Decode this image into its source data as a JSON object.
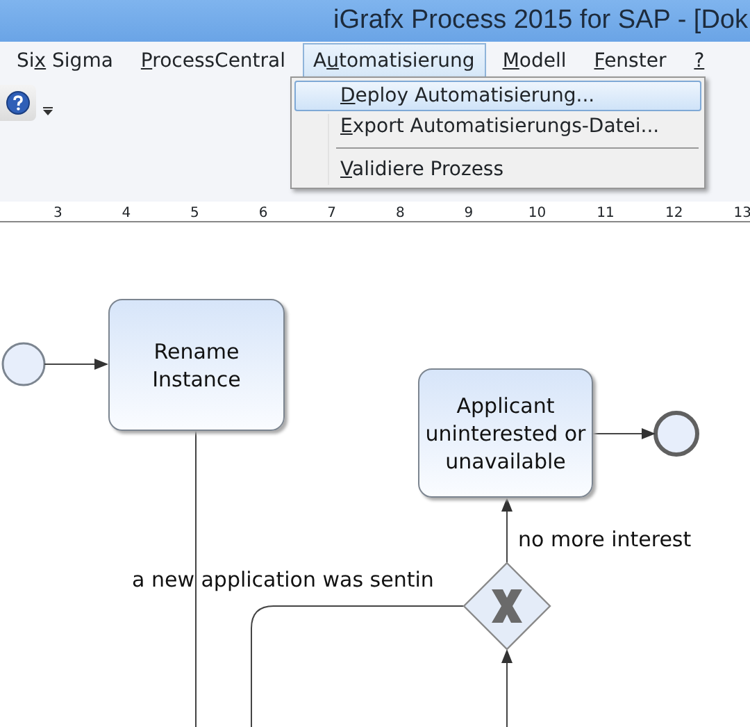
{
  "window": {
    "title": "iGrafx Process 2015 for SAP - [Dok"
  },
  "menu": [
    {
      "parts": [
        {
          "text": "Si",
          "underlined": false
        },
        {
          "text": "x",
          "underlined": true
        },
        {
          "text": " Sigma",
          "underlined": false
        }
      ],
      "selected": false
    },
    {
      "parts": [
        {
          "text": "P",
          "underlined": true
        },
        {
          "text": "rocessCentral",
          "underlined": false
        }
      ],
      "selected": false
    },
    {
      "parts": [
        {
          "text": "A",
          "underlined": false
        },
        {
          "text": "u",
          "underlined": true
        },
        {
          "text": "tomatisierung",
          "underlined": false
        }
      ],
      "selected": true
    },
    {
      "parts": [
        {
          "text": "M",
          "underlined": true
        },
        {
          "text": "odell",
          "underlined": false
        }
      ],
      "selected": false
    },
    {
      "parts": [
        {
          "text": "F",
          "underlined": true
        },
        {
          "text": "enster",
          "underlined": false
        }
      ],
      "selected": false
    },
    {
      "parts": [
        {
          "text": "?",
          "underlined": true
        }
      ],
      "selected": false
    }
  ],
  "dropdown": [
    {
      "kind": "item",
      "parts": [
        {
          "text": "D",
          "underlined": true
        },
        {
          "text": "eploy Automatisierung...",
          "underlined": false
        }
      ],
      "selected": true
    },
    {
      "kind": "item",
      "parts": [
        {
          "text": "E",
          "underlined": true
        },
        {
          "text": "xport Automatisierungs-Datei...",
          "underlined": false
        }
      ],
      "selected": false
    },
    {
      "kind": "separator"
    },
    {
      "kind": "item",
      "parts": [
        {
          "text": "V",
          "underlined": true
        },
        {
          "text": "alidiere Prozess",
          "underlined": false
        }
      ],
      "selected": false
    }
  ],
  "ruler": {
    "numbers": [
      "3",
      "4",
      "5",
      "6",
      "7",
      "8",
      "9",
      "10",
      "11",
      "12",
      "13"
    ]
  },
  "diagram": {
    "tasks": [
      {
        "label": "Rename Instance"
      },
      {
        "label": "Applicant uninterested or unavailable"
      }
    ],
    "edge_labels": [
      "a new application was sentin",
      "no more interest"
    ]
  }
}
